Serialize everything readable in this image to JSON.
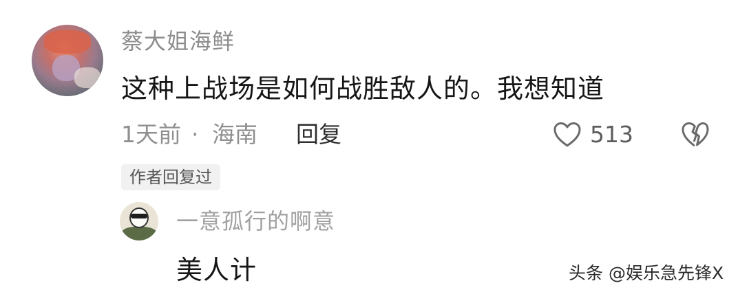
{
  "comment": {
    "username": "蔡大姐海鲜",
    "text": "这种上战场是如何战胜敌人的。我想知道",
    "time": "1天前",
    "separator": "·",
    "region": "海南",
    "reply_label": "回复",
    "like_icon": "heart-outline-icon",
    "like_count": "513",
    "dislike_icon": "broken-heart-icon",
    "author_badge": "作者回复过"
  },
  "reply": {
    "username": "一意孤行的啊意",
    "text": "美人计"
  },
  "watermark": "头条 @娱乐急先锋X",
  "colors": {
    "primary_text": "#161616",
    "secondary_text": "#8f8f8f",
    "badge_bg": "#f1f1f1"
  }
}
